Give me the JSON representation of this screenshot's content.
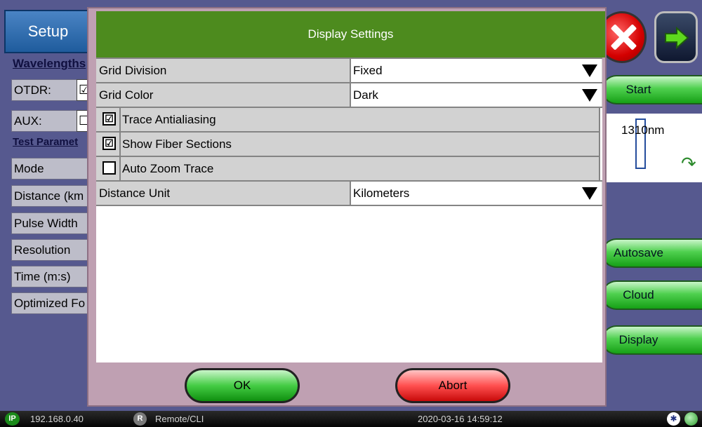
{
  "background": {
    "setup_tab": "Setup",
    "wavelengths_link": "Wavelengths",
    "otdr_label": "OTDR:",
    "otdr_check": "☑",
    "aux_label": "AUX:",
    "aux_check": "☐",
    "test_params_link": "Test Paramet",
    "rows": [
      "Mode",
      "Distance (km",
      "Pulse Width",
      "Resolution",
      "Time (m:s)",
      "Optimized Fo"
    ],
    "side_buttons": {
      "start": "Start",
      "autosave": "Autosave",
      "cloud": "Cloud",
      "display": "Display"
    },
    "wavelength": "1310nm"
  },
  "dialog": {
    "title": "Display Settings",
    "grid_division": {
      "label": "Grid Division",
      "value": "Fixed"
    },
    "grid_color": {
      "label": "Grid Color",
      "value": "Dark"
    },
    "trace_antialiasing": {
      "label": "Trace Antialiasing",
      "checked": true,
      "mark": "☑"
    },
    "show_fiber_sections": {
      "label": "Show Fiber Sections",
      "checked": true,
      "mark": "☑"
    },
    "auto_zoom_trace": {
      "label": "Auto Zoom Trace",
      "checked": false,
      "mark": ""
    },
    "distance_unit": {
      "label": "Distance Unit",
      "value": "Kilometers"
    },
    "ok": "OK",
    "abort": "Abort"
  },
  "statusbar": {
    "ip_badge": "IP",
    "ip": "192.168.0.40",
    "remote_badge": "R",
    "remote": "Remote/CLI",
    "datetime": "2020-03-16  14:59:12",
    "bt_glyph": "✱"
  },
  "colors": {
    "title_bar": "#4d8b1e",
    "dialog_frame": "#bfa0b2",
    "screen_bg": "#56598f",
    "ok_green": "#44cc44",
    "abort_red": "#ff5050"
  }
}
